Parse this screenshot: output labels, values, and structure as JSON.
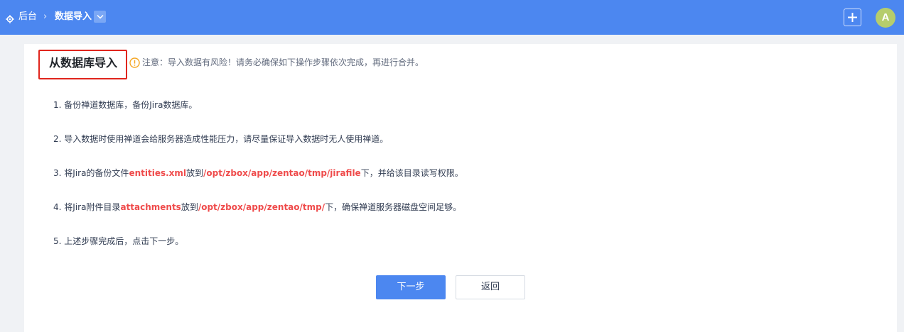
{
  "header": {
    "home_label": "后台",
    "separator": "›",
    "current_label": "数据导入",
    "avatar_letter": "A",
    "accent_color": "#4c87f0",
    "icons": [
      "gear-icon",
      "chevron-down-icon",
      "plus-icon"
    ]
  },
  "main": {
    "title": "从数据库导入",
    "notice": "注意：导入数据有风险！请务必确保如下操作步骤依次完成，再进行合并。",
    "steps": [
      {
        "text": "1. 备份禅道数据库，备份Jira数据库。"
      },
      {
        "text": "2. 导入数据时使用禅道会给服务器造成性能压力，请尽量保证导入数据时无人使用禅道。"
      },
      {
        "pre": "3. 将Jira的备份文件",
        "hl1": "entities.xml",
        "mid": "放到",
        "hl2": "/opt/zbox/app/zentao/tmp/jirafile",
        "post": "下，并给该目录读写权限。"
      },
      {
        "pre": "4. 将Jira附件目录",
        "hl1": "attachments",
        "mid": "放到",
        "hl2": "/opt/zbox/app/zentao/tmp/",
        "post": "下，确保禅道服务器磁盘空间足够。"
      },
      {
        "text": "5. 上述步骤完成后，点击下一步。"
      }
    ],
    "highlight_color": "#ef4b4b",
    "annotation_color": "#e0251d"
  },
  "actions": {
    "next_label": "下一步",
    "back_label": "返回"
  }
}
